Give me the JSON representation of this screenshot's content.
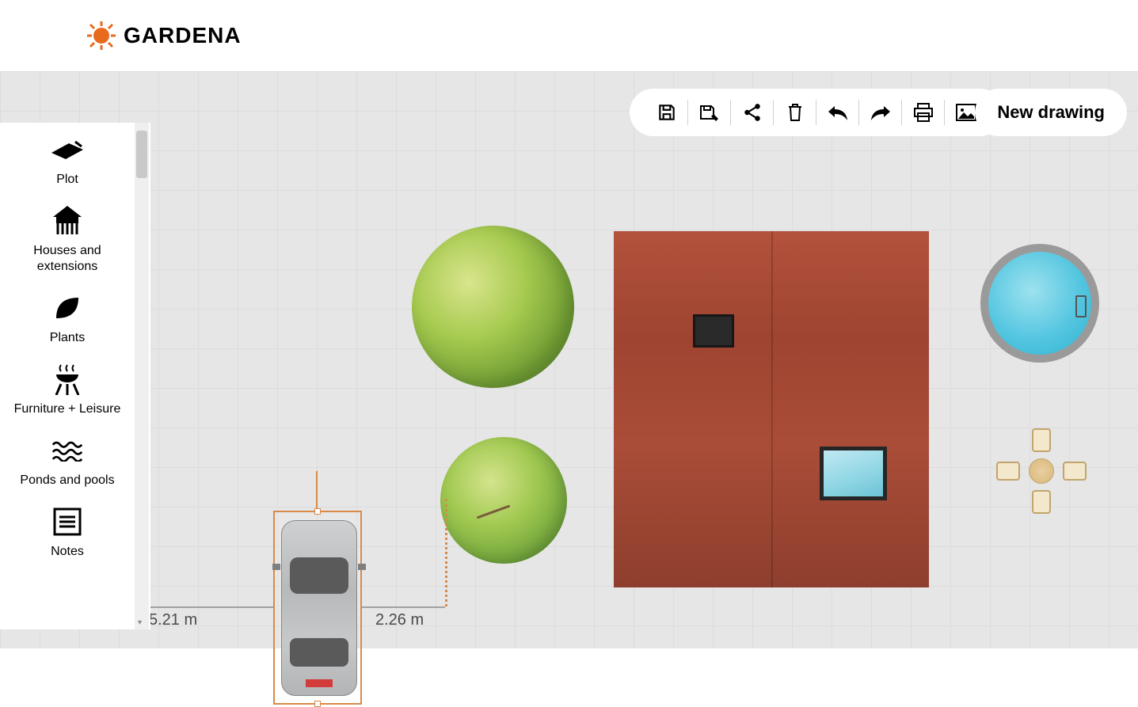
{
  "brand": {
    "name": "GARDENA"
  },
  "palette": {
    "items": [
      {
        "label": "Plot",
        "icon": "plot-icon"
      },
      {
        "label": "Houses and extensions",
        "icon": "house-icon"
      },
      {
        "label": "Plants",
        "icon": "leaf-icon"
      },
      {
        "label": "Furniture + Leisure",
        "icon": "bbq-icon"
      },
      {
        "label": "Ponds and pools",
        "icon": "water-icon"
      },
      {
        "label": "Notes",
        "icon": "notes-icon"
      }
    ]
  },
  "toolbar": {
    "save": "Save",
    "save_as": "Save as",
    "share": "Share",
    "delete": "Delete",
    "undo": "Undo",
    "redo": "Redo",
    "print": "Print",
    "image": "Export image"
  },
  "new_drawing": "New drawing",
  "measurements": {
    "left": "5.21 m",
    "right": "2.26 m"
  },
  "canvas_objects": {
    "tree_large": "Large tree",
    "tree_small": "Small tree",
    "house": "House",
    "pool": "Round pool",
    "table": "Table with chairs",
    "car": "Car (selected)"
  }
}
